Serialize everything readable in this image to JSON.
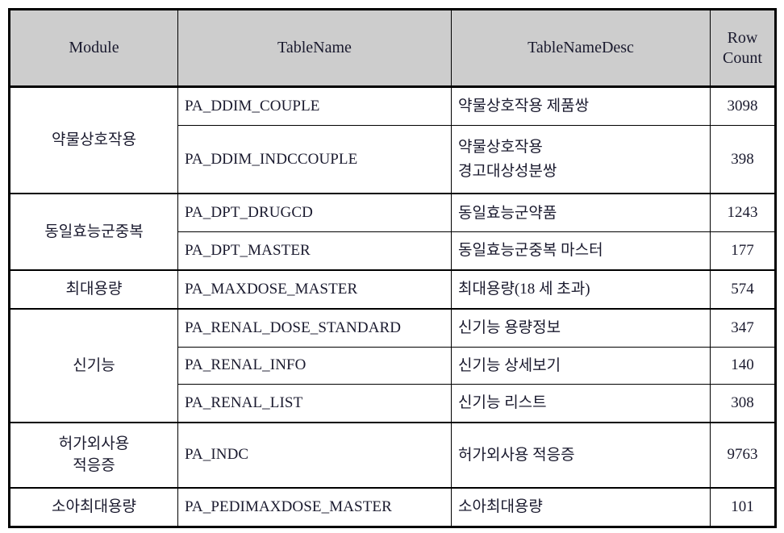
{
  "table": {
    "columns": [
      {
        "key": "module",
        "label": "Module"
      },
      {
        "key": "tablename",
        "label": "TableName"
      },
      {
        "key": "desc",
        "label": "TableNameDesc"
      },
      {
        "key": "rowcount",
        "label": "Row\nCount",
        "label_line1": "Row",
        "label_line2": "Count"
      }
    ],
    "header_bg": "#cdcdcd",
    "border_color": "#000000",
    "text_color": "#1a1a2e",
    "groups": [
      {
        "module": "약물상호작용",
        "rows": [
          {
            "tablename": "PA_DDIM_COUPLE",
            "desc_line1": "약물상호작용 제품쌍",
            "desc_line2": "",
            "rowcount": "3098"
          },
          {
            "tablename": "PA_DDIM_INDCCOUPLE",
            "desc_line1": "약물상호작용",
            "desc_line2": "경고대상성분쌍",
            "rowcount": "398"
          }
        ]
      },
      {
        "module": "동일효능군중복",
        "rows": [
          {
            "tablename": "PA_DPT_DRUGCD",
            "desc_line1": "동일효능군약품",
            "desc_line2": "",
            "rowcount": "1243"
          },
          {
            "tablename": "PA_DPT_MASTER",
            "desc_line1": "동일효능군중복 마스터",
            "desc_line2": "",
            "rowcount": "177"
          }
        ]
      },
      {
        "module": "최대용량",
        "rows": [
          {
            "tablename": "PA_MAXDOSE_MASTER",
            "desc_line1": "최대용량(18 세 초과)",
            "desc_line2": "",
            "rowcount": "574"
          }
        ]
      },
      {
        "module": "신기능",
        "rows": [
          {
            "tablename": "PA_RENAL_DOSE_STANDARD",
            "desc_line1": "신기능 용량정보",
            "desc_line2": "",
            "rowcount": "347"
          },
          {
            "tablename": "PA_RENAL_INFO",
            "desc_line1": "신기능 상세보기",
            "desc_line2": "",
            "rowcount": "140"
          },
          {
            "tablename": "PA_RENAL_LIST",
            "desc_line1": "신기능 리스트",
            "desc_line2": "",
            "rowcount": "308"
          }
        ]
      },
      {
        "module": "허가외사용 적응증",
        "module_line1": "허가외사용",
        "module_line2": "적응증",
        "rows": [
          {
            "tablename": "PA_INDC",
            "desc_line1": "허가외사용 적응증",
            "desc_line2": "",
            "rowcount": "9763"
          }
        ]
      },
      {
        "module": "소아최대용량",
        "rows": [
          {
            "tablename": "PA_PEDIMAXDOSE_MASTER",
            "desc_line1": "소아최대용량",
            "desc_line2": "",
            "rowcount": "101"
          }
        ]
      }
    ]
  }
}
